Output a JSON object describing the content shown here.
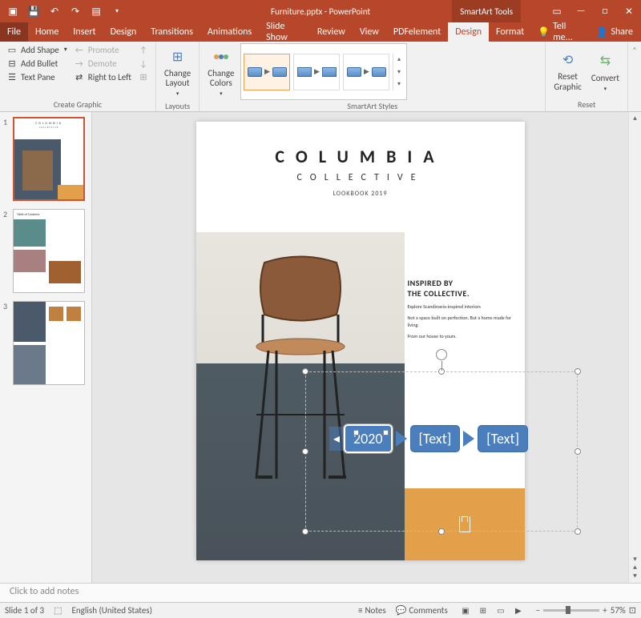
{
  "titlebar": {
    "doc_title": "Furniture.pptx - PowerPoint",
    "smartart_tools": "SmartArt Tools"
  },
  "tabs": {
    "file": "File",
    "home": "Home",
    "insert": "Insert",
    "design": "Design",
    "transitions": "Transitions",
    "animations": "Animations",
    "slideshow": "Slide Show",
    "review": "Review",
    "view": "View",
    "pdfelement": "PDFelement",
    "sa_design": "Design",
    "format": "Format",
    "tell_me": "Tell me...",
    "share": "Share"
  },
  "ribbon": {
    "create_graphic": {
      "label": "Create Graphic",
      "add_shape": "Add Shape",
      "add_bullet": "Add Bullet",
      "text_pane": "Text Pane",
      "promote": "Promote",
      "demote": "Demote",
      "right_to_left": "Right to Left",
      "move_up": "",
      "move_down": "",
      "layout": ""
    },
    "layouts": {
      "label": "Layouts",
      "change_layout": "Change\nLayout"
    },
    "smartart_styles": {
      "label": "SmartArt Styles",
      "change_colors": "Change\nColors"
    },
    "reset": {
      "label": "Reset",
      "reset_graphic": "Reset\nGraphic",
      "convert": "Convert"
    }
  },
  "slide": {
    "title": "COLUMBIA",
    "subtitle": "COLLECTIVE",
    "lookbook": "LOOKBOOK 2019",
    "side": {
      "h1": "INSPIRED BY",
      "h2": "THE COLLECTIVE.",
      "p1": "Explore Scandinavia-inspired interiors",
      "p2": "",
      "p3": "Not a space built on perfection. But a home made for living.",
      "p4": "From our house to yours."
    },
    "smartart": {
      "n1": "2020",
      "n2": "[Text]",
      "n3": "[Text]"
    }
  },
  "thumbs": {
    "t1": {
      "num": "1",
      "title": "COLUMBIA",
      "sub": "COLLECTIVE"
    },
    "t2": {
      "num": "2",
      "title": "Table of Contents"
    },
    "t3": {
      "num": "3"
    }
  },
  "notes": {
    "placeholder": "Click to add notes"
  },
  "status": {
    "slide_counter": "Slide 1 of 3",
    "language": "English (United States)",
    "notes": "Notes",
    "comments": "Comments",
    "zoom_minus": "−",
    "zoom_plus": "+",
    "zoom_pct": "57%"
  }
}
